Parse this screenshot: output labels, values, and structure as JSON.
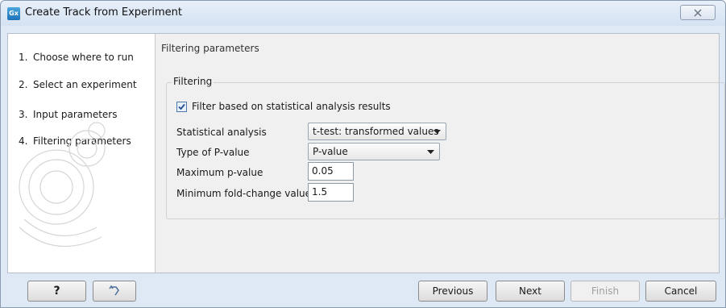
{
  "window": {
    "title": "Create Track from Experiment",
    "app_icon_text": "Gx"
  },
  "steps": [
    {
      "num": "1.",
      "label": "Choose where to run"
    },
    {
      "num": "2.",
      "label": "Select an experiment"
    },
    {
      "num": "3.",
      "label": "Input parameters"
    },
    {
      "num": "4.",
      "label": "Filtering parameters"
    }
  ],
  "content": {
    "section_title": "Filtering parameters",
    "group_label": "Filtering",
    "filter_checkbox": {
      "label": "Filter based on statistical analysis results",
      "checked": true
    },
    "statistical_analysis": {
      "label": "Statistical analysis",
      "value": "t-test: transformed values"
    },
    "p_value_type": {
      "label": "Type of P-value",
      "value": "P-value"
    },
    "max_p_value": {
      "label": "Maximum p-value",
      "value": "0.05"
    },
    "min_fold_change": {
      "label": "Minimum fold-change value",
      "value": "1.5"
    }
  },
  "footer": {
    "help_label": "?",
    "previous_label": "Previous",
    "next_label": "Next",
    "finish_label": "Finish",
    "cancel_label": "Cancel"
  },
  "icons": {
    "app": "gx-app-icon",
    "close": "close-icon",
    "reset": "reset-arrow-icon",
    "checkbox": "checkmark-icon",
    "dropdown": "chevron-down-icon",
    "watermark": "dna-watermark-icon"
  }
}
